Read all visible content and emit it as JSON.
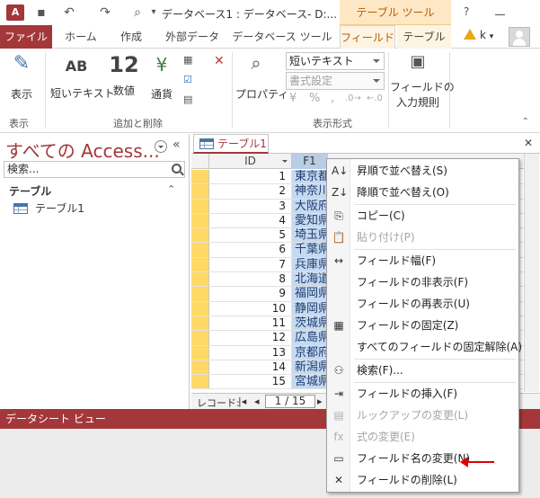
{
  "titlebar": {
    "title": "データベース1 : データベース- D:...",
    "contextual_tab": "テーブル ツール",
    "help": "?"
  },
  "tabs": [
    "ファイル",
    "ホーム",
    "作成",
    "外部データ",
    "データベース ツール",
    "フィールド",
    "テーブル"
  ],
  "active_tab": "フィールド",
  "user": {
    "initial": "k"
  },
  "ribbon": {
    "view_label": "表示",
    "short_text_label": "短いテキスト",
    "short_text_icon": "AB",
    "number_label": "数値",
    "number_icon": "12",
    "currency_label": "通貨",
    "properties_label": "プロパティ",
    "datatype_value": "短いテキスト",
    "format_value": "書式設定",
    "percent": "%",
    "comma": ",",
    "validation_line1": "フィールドの",
    "validation_line2": "入力規則",
    "groups": [
      "表示",
      "追加と削除",
      "表示形式"
    ]
  },
  "nav": {
    "title": "すべての Access...",
    "search_placeholder": "検索...",
    "section": "テーブル",
    "items": [
      "テーブル1"
    ]
  },
  "document": {
    "tab_label": "テーブル1",
    "columns": [
      "ID",
      "F1"
    ],
    "rows": [
      {
        "id": "1",
        "f1": "東京都"
      },
      {
        "id": "2",
        "f1": "神奈川"
      },
      {
        "id": "3",
        "f1": "大阪府"
      },
      {
        "id": "4",
        "f1": "愛知県"
      },
      {
        "id": "5",
        "f1": "埼玉県"
      },
      {
        "id": "6",
        "f1": "千葉県"
      },
      {
        "id": "7",
        "f1": "兵庫県"
      },
      {
        "id": "8",
        "f1": "北海道"
      },
      {
        "id": "9",
        "f1": "福岡県"
      },
      {
        "id": "10",
        "f1": "静岡県"
      },
      {
        "id": "11",
        "f1": "茨城県"
      },
      {
        "id": "12",
        "f1": "広島県"
      },
      {
        "id": "13",
        "f1": "京都府"
      },
      {
        "id": "14",
        "f1": "新潟県"
      },
      {
        "id": "15",
        "f1": "宮城県"
      }
    ],
    "record_label": "レコード:",
    "record_position": "1 / 15"
  },
  "status": {
    "text": "データシート ビュー"
  },
  "context_menu": {
    "items": [
      {
        "label": "昇順で並べ替え(S)",
        "icon": "sort-ascending-icon",
        "glyph": "A↓",
        "disabled": false
      },
      {
        "label": "降順で並べ替え(O)",
        "icon": "sort-descending-icon",
        "glyph": "Z↓",
        "disabled": false
      },
      {
        "label": "コピー(C)",
        "icon": "copy-icon",
        "glyph": "⎘",
        "disabled": false
      },
      {
        "label": "貼り付け(P)",
        "icon": "paste-icon",
        "glyph": "📋",
        "disabled": true
      },
      {
        "label": "フィールド幅(F)",
        "icon": "field-width-icon",
        "glyph": "↔",
        "disabled": false
      },
      {
        "label": "フィールドの非表示(F)",
        "icon": "",
        "glyph": "",
        "disabled": false
      },
      {
        "label": "フィールドの再表示(U)",
        "icon": "",
        "glyph": "",
        "disabled": false
      },
      {
        "label": "フィールドの固定(Z)",
        "icon": "freeze-icon",
        "glyph": "▦",
        "disabled": false
      },
      {
        "label": "すべてのフィールドの固定解除(A)",
        "icon": "",
        "glyph": "",
        "disabled": false
      },
      {
        "label": "検索(F)...",
        "icon": "binoculars-icon",
        "glyph": "⚇",
        "disabled": false
      },
      {
        "label": "フィールドの挿入(F)",
        "icon": "insert-field-icon",
        "glyph": "⇥",
        "disabled": false
      },
      {
        "label": "ルックアップの変更(L)",
        "icon": "lookup-icon",
        "glyph": "▤",
        "disabled": true
      },
      {
        "label": "式の変更(E)",
        "icon": "fx-icon",
        "glyph": "fx",
        "disabled": true
      },
      {
        "label": "フィールド名の変更(N)",
        "icon": "rename-icon",
        "glyph": "▭",
        "disabled": false
      },
      {
        "label": "フィールドの削除(L)",
        "icon": "delete-icon",
        "glyph": "✕",
        "disabled": false
      }
    ]
  },
  "colors": {
    "accent": "#a4373a",
    "contextual": "#b85c00",
    "highlight_column": "#c5d9f1",
    "row_selector": "#ffd966",
    "annotation_arrow": "#e00000"
  }
}
